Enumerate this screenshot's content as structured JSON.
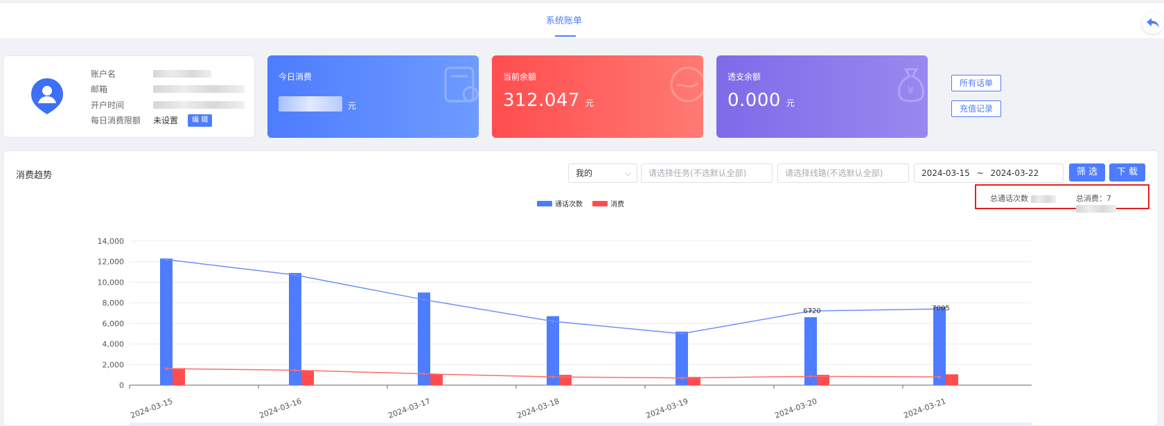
{
  "header": {
    "tab_label": "系统账单"
  },
  "account": {
    "rows": [
      {
        "label": "账户名"
      },
      {
        "label": "邮箱"
      },
      {
        "label": "开户时间"
      },
      {
        "label": "每日消费限额",
        "value": "未设置",
        "button": "编 辑"
      }
    ]
  },
  "stats": [
    {
      "title": "今日消费",
      "unit": "元",
      "color": "#4d7cfe",
      "icon": "bill-icon"
    },
    {
      "title": "当前余额",
      "amount": "312.047",
      "unit": "元",
      "color": "#ff4d4f",
      "icon": "wallet-icon"
    },
    {
      "title": "透支余额",
      "amount": "0.000",
      "unit": "元",
      "color": "#7f6ae8",
      "icon": "money-bag-icon"
    }
  ],
  "links": {
    "all_calls": "所有话单",
    "recharge": "充值记录"
  },
  "trend": {
    "title": "消费趋势",
    "owner_select": "我的",
    "task_placeholder": "请选择任务(不选默认全部)",
    "route_placeholder": "请选择线路(不选默认全部)",
    "date_start": "2024-03-15",
    "date_sep": "~",
    "date_end": "2024-03-22",
    "filter_btn": "筛 选",
    "download_btn": "下 载",
    "total_calls_label": "总通话次数",
    "total_cost_label": "总消费：7"
  },
  "chart_data": {
    "type": "bar",
    "categories": [
      "2024-03-15",
      "2024-03-16",
      "2024-03-17",
      "2024-03-18",
      "2024-03-19",
      "2024-03-20",
      "2024-03-21"
    ],
    "series": [
      {
        "name": "通话次数",
        "color": "#4d7cfe",
        "values": [
          12300,
          10900,
          9000,
          6700,
          5200,
          6600,
          7600
        ]
      },
      {
        "name": "消费",
        "color": "#ff4d4f",
        "values": [
          1650,
          1450,
          1050,
          1000,
          800,
          1000,
          1050
        ]
      }
    ],
    "line_series": [
      {
        "color": "#6e8ff8",
        "values": [
          12200,
          10700,
          8300,
          6200,
          5000,
          7200,
          7400
        ]
      },
      {
        "color": "#ff6b6b",
        "values": [
          1600,
          1450,
          1100,
          800,
          700,
          850,
          800
        ]
      }
    ],
    "data_labels": [
      "6720",
      "7005"
    ],
    "yticks": [
      "0",
      "2,000",
      "4,000",
      "6,000",
      "8,000",
      "10,000",
      "12,000",
      "14,000"
    ],
    "ylim": [
      0,
      14000
    ],
    "legend": "top-center"
  }
}
